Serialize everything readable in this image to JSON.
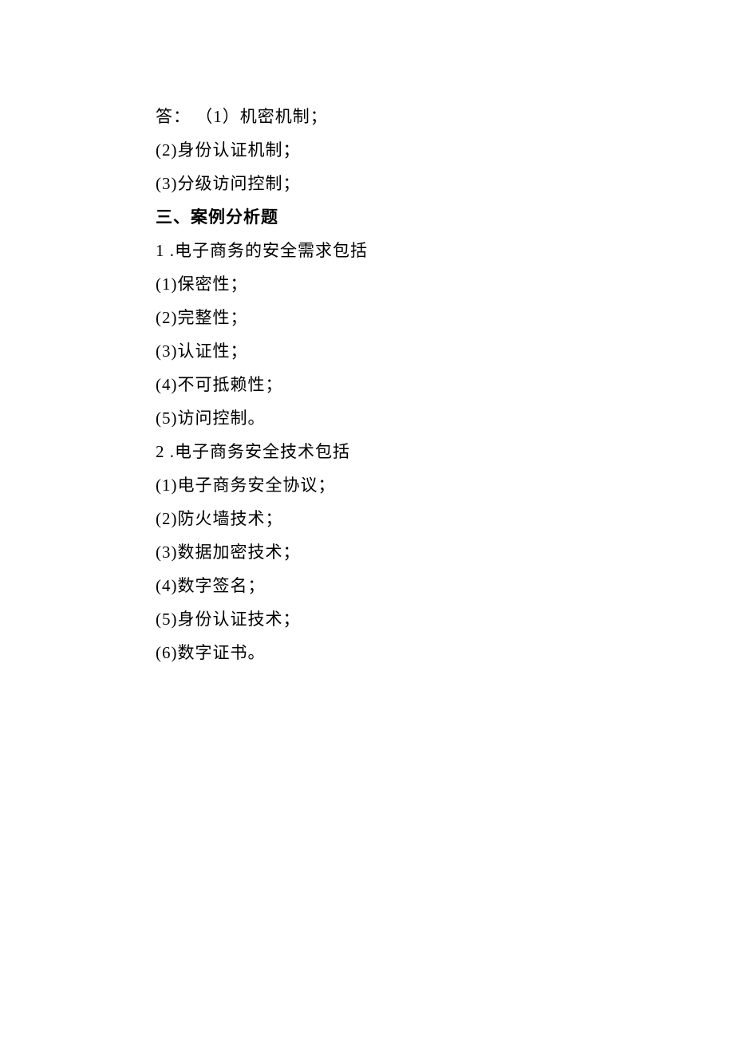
{
  "lines": [
    {
      "text": "答： （1）机密机制；",
      "bold": false
    },
    {
      "text": "(2)身份认证机制；",
      "bold": false
    },
    {
      "text": "(3)分级访问控制；",
      "bold": false
    },
    {
      "text": "三、案例分析题",
      "bold": true
    },
    {
      "text": "1 .电子商务的安全需求包括",
      "bold": false
    },
    {
      "text": "(1)保密性；",
      "bold": false
    },
    {
      "text": "(2)完整性；",
      "bold": false
    },
    {
      "text": "(3)认证性；",
      "bold": false
    },
    {
      "text": "(4)不可抵赖性；",
      "bold": false
    },
    {
      "text": "(5)访问控制。",
      "bold": false
    },
    {
      "text": "2  .电子商务安全技术包括",
      "bold": false
    },
    {
      "text": "(1)电子商务安全协议；",
      "bold": false
    },
    {
      "text": "(2)防火墙技术；",
      "bold": false
    },
    {
      "text": "(3)数据加密技术；",
      "bold": false
    },
    {
      "text": "(4)数字签名；",
      "bold": false
    },
    {
      "text": "(5)身份认证技术；",
      "bold": false
    },
    {
      "text": "(6)数字证书。",
      "bold": false
    }
  ]
}
